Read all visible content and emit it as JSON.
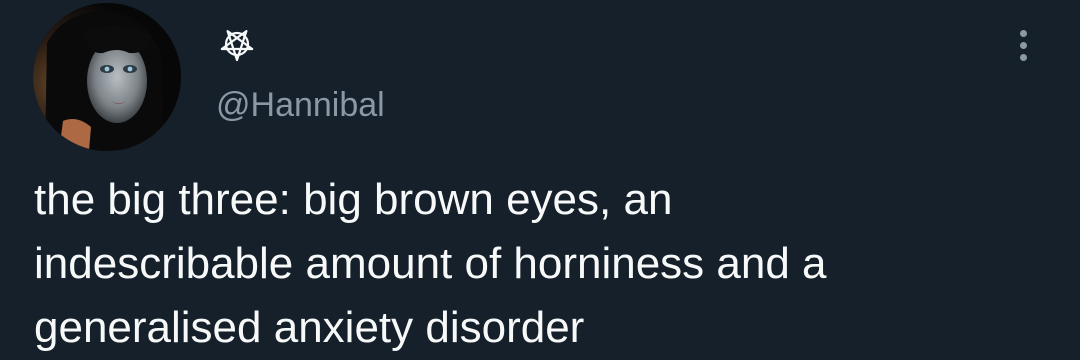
{
  "tweet": {
    "author": {
      "display_name": "⛧",
      "handle": "@Hannibal",
      "avatar_icon": "profile-photo-dark-portrait"
    },
    "more_icon": "more-vertical-icon",
    "text": "the big three: big brown eyes, an\nindescribable amount of horniness and a\ngeneralised anxiety disorder"
  },
  "colors": {
    "background": "#15202b",
    "text_primary": "#f7f9f9",
    "text_secondary": "#8b98a5"
  }
}
